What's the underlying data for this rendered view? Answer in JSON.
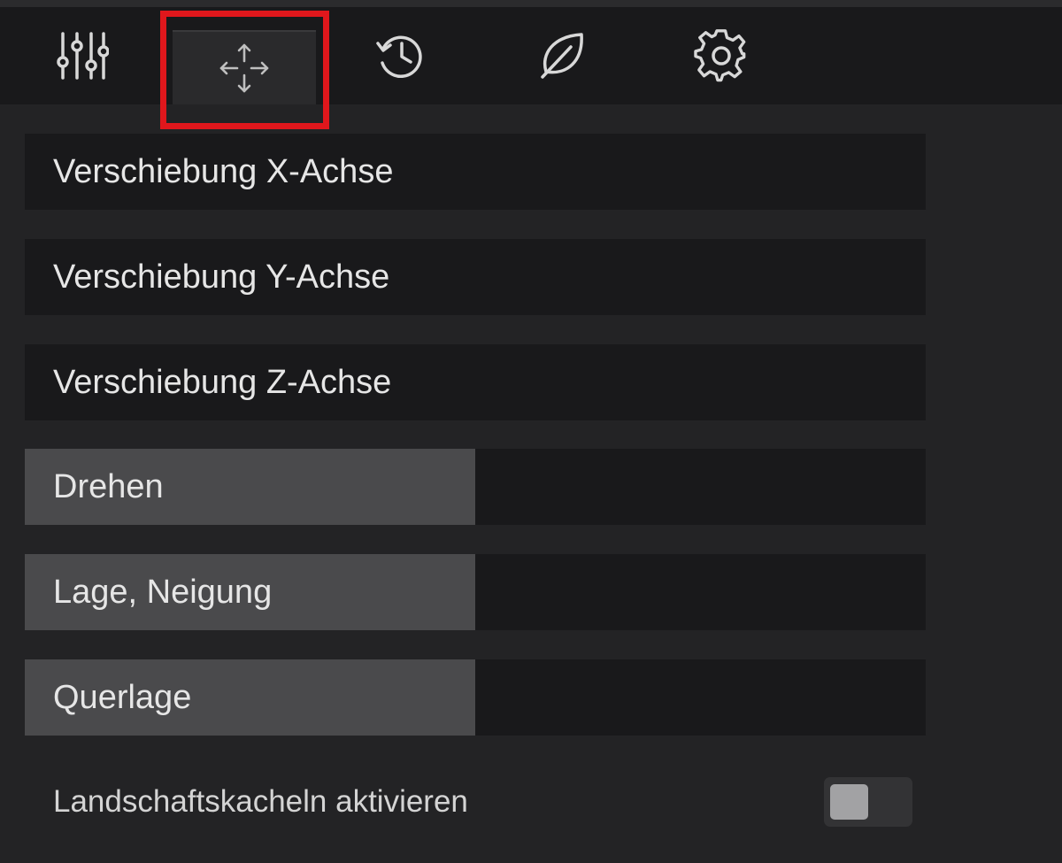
{
  "tabs": [
    {
      "icon": "sliders-icon",
      "active": false
    },
    {
      "icon": "move-arrows-icon",
      "active": true
    },
    {
      "icon": "history-icon",
      "active": false
    },
    {
      "icon": "leaf-icon",
      "active": false
    },
    {
      "icon": "gear-icon",
      "active": false
    }
  ],
  "controls": {
    "shift_x": {
      "label": "Verschiebung X-Achse",
      "value_fraction": 0.0
    },
    "shift_y": {
      "label": "Verschiebung Y-Achse",
      "value_fraction": 0.0
    },
    "shift_z": {
      "label": "Verschiebung Z-Achse",
      "value_fraction": 0.0
    },
    "rotate": {
      "label": "Drehen",
      "value_fraction": 0.5
    },
    "pitch": {
      "label": "Lage, Neigung",
      "value_fraction": 0.5
    },
    "roll": {
      "label": "Querlage",
      "value_fraction": 0.5
    }
  },
  "landscape_tiles": {
    "label": "Landschaftskacheln aktivieren",
    "enabled": false
  },
  "colors": {
    "highlight": "#e0171c",
    "fill": "#4a4a4c",
    "background": "#232325"
  }
}
